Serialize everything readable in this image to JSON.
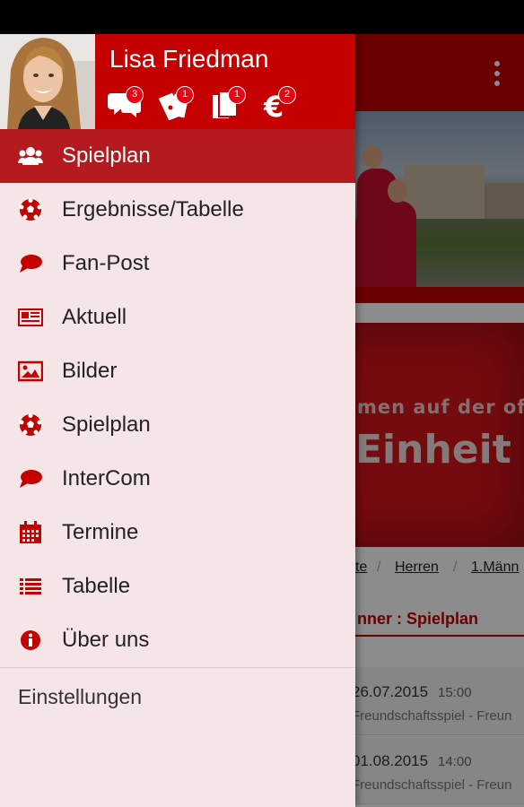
{
  "colors": {
    "primary": "#c40000",
    "active_row": "#b51a1f",
    "drawer_bg": "#f6e5e7",
    "badge": "#e30613"
  },
  "user": {
    "name": "Lisa Friedman"
  },
  "header_icons": [
    {
      "icon": "chat-bubbles-icon",
      "count": "3"
    },
    {
      "icon": "tickets-icon",
      "count": "1"
    },
    {
      "icon": "documents-icon",
      "count": "1"
    },
    {
      "icon": "euro-icon",
      "count": "2"
    }
  ],
  "menu": [
    {
      "icon": "users-icon",
      "label": "Spielplan",
      "active": true
    },
    {
      "icon": "soccer-ball-icon",
      "label": "Ergebnisse/Tabelle"
    },
    {
      "icon": "speech-bubble-icon",
      "label": "Fan-Post"
    },
    {
      "icon": "newspaper-icon",
      "label": "Aktuell"
    },
    {
      "icon": "image-icon",
      "label": "Bilder"
    },
    {
      "icon": "soccer-ball-icon",
      "label": "Spielplan"
    },
    {
      "icon": "speech-bubble-icon",
      "label": "InterCom"
    },
    {
      "icon": "calendar-icon",
      "label": "Termine"
    },
    {
      "icon": "list-icon",
      "label": "Tabelle"
    },
    {
      "icon": "info-icon",
      "label": "Über uns"
    }
  ],
  "settings": {
    "label": "Einstellungen"
  },
  "background": {
    "banner_line1": "men auf der offi",
    "banner_line2": "Einheit W",
    "breadcrumbs": [
      "te",
      "Herren",
      "1.Männ"
    ],
    "subtitle": "nner : Spielplan",
    "games": [
      {
        "date": "26.07.2015",
        "time": "15:00",
        "type": "Freundschaftsspiel - Freun"
      },
      {
        "date": "01.08.2015",
        "time": "14:00",
        "type": "Freundschaftsspiel - Freun"
      }
    ]
  }
}
